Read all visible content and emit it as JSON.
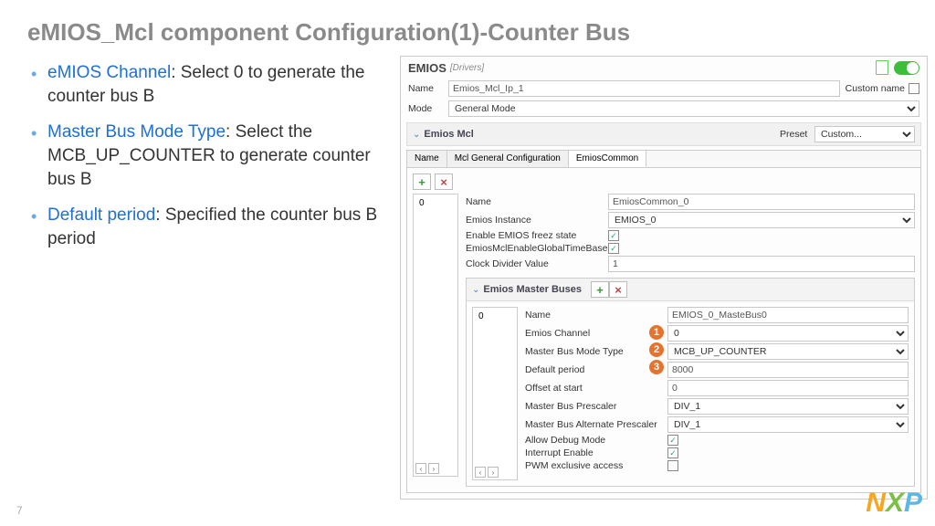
{
  "slide": {
    "title": "eMIOS_Mcl component Configuration(1)-Counter Bus",
    "page_number": "7",
    "bullets": [
      {
        "term": "eMIOS Channel",
        "rest": ": Select 0 to generate the counter bus B"
      },
      {
        "term": "Master Bus Mode Type",
        "rest": ": Select the MCB_UP_COUNTER to generate counter bus B"
      },
      {
        "term": "Default period",
        "rest": ": Specified the counter bus B period"
      }
    ]
  },
  "panel": {
    "title": "EMIOS",
    "subtitle": "[Drivers]",
    "name_label": "Name",
    "name_value": "Emios_Mcl_Ip_1",
    "custom_name_label": "Custom name",
    "mode_label": "Mode",
    "mode_value": "General Mode",
    "section_title": "Emios Mcl",
    "preset_label": "Preset",
    "preset_value": "Custom...",
    "tabs": [
      "Name",
      "Mcl General Configuration",
      "EmiosCommon"
    ],
    "list_item": "0",
    "form": {
      "name_label": "Name",
      "name_value": "EmiosCommon_0",
      "instance_label": "Emios Instance",
      "instance_value": "EMIOS_0",
      "freeze_label": "Enable EMIOS freez state",
      "freeze_checked": "✓",
      "global_tb_label": "EmiosMclEnableGlobalTimeBase",
      "global_tb_checked": "✓",
      "clock_div_label": "Clock Divider Value",
      "clock_div_value": "1"
    },
    "sub": {
      "title": "Emios Master Buses",
      "list_item": "0",
      "fields": {
        "name_label": "Name",
        "name_value": "EMIOS_0_MasteBus0",
        "channel_label": "Emios Channel",
        "channel_value": "0",
        "mode_label": "Master Bus Mode Type",
        "mode_value": "MCB_UP_COUNTER",
        "period_label": "Default period",
        "period_value": "8000",
        "offset_label": "Offset at start",
        "offset_value": "0",
        "presc_label": "Master Bus Prescaler",
        "presc_value": "DIV_1",
        "alt_presc_label": "Master Bus Alternate Prescaler",
        "alt_presc_value": "DIV_1",
        "debug_label": "Allow Debug Mode",
        "debug_checked": "✓",
        "irq_label": "Interrupt Enable",
        "irq_checked": "✓",
        "pwm_label": "PWM exclusive access",
        "pwm_checked": ""
      }
    }
  },
  "badges": {
    "b1": "1",
    "b2": "2",
    "b3": "3"
  }
}
